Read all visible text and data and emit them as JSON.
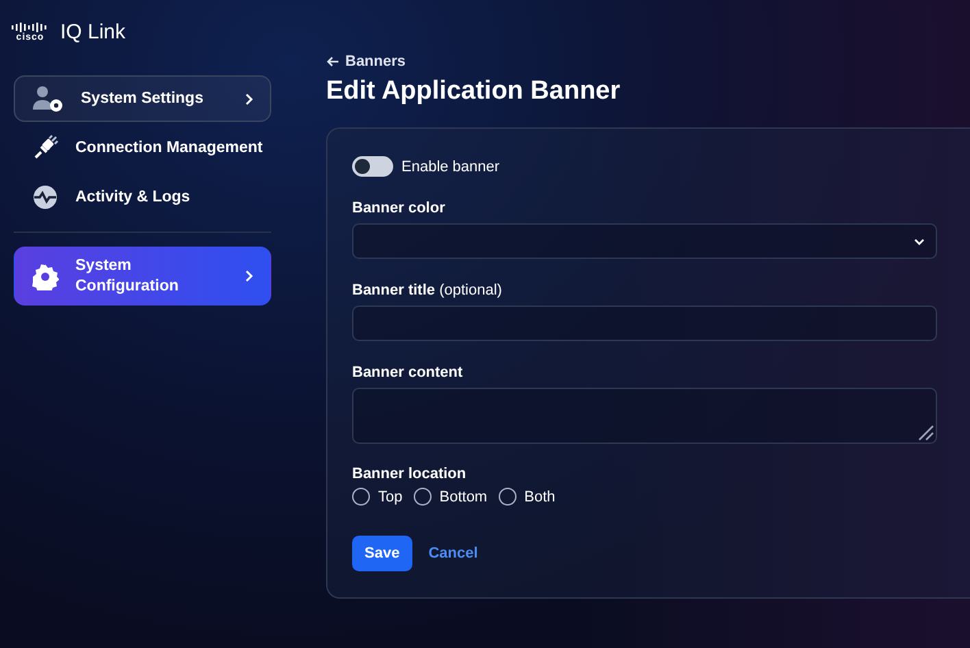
{
  "brand": {
    "wordmark": "cisco",
    "product": "IQ Link"
  },
  "sidebar": {
    "items": [
      {
        "label": "System Settings",
        "kind": "outlined",
        "selected": false
      },
      {
        "label": "Connection Management",
        "kind": "plain",
        "selected": false
      },
      {
        "label": "Activity & Logs",
        "kind": "plain",
        "selected": false
      },
      {
        "label": "System Configuration",
        "kind": "plain",
        "selected": true
      }
    ]
  },
  "breadcrumb": "Banners",
  "title": "Edit Application Banner",
  "form": {
    "toggle": {
      "label": "Enable banner",
      "on": false
    },
    "color_label": "Banner color",
    "title_label": "Banner title",
    "title_hint": "(optional)",
    "content_label": "Banner content",
    "location_label": "Banner location",
    "locations": [
      {
        "label": "Top",
        "selected": false
      },
      {
        "label": "Bottom",
        "selected": false
      },
      {
        "label": "Both",
        "selected": false
      }
    ],
    "save": "Save",
    "cancel": "Cancel"
  }
}
